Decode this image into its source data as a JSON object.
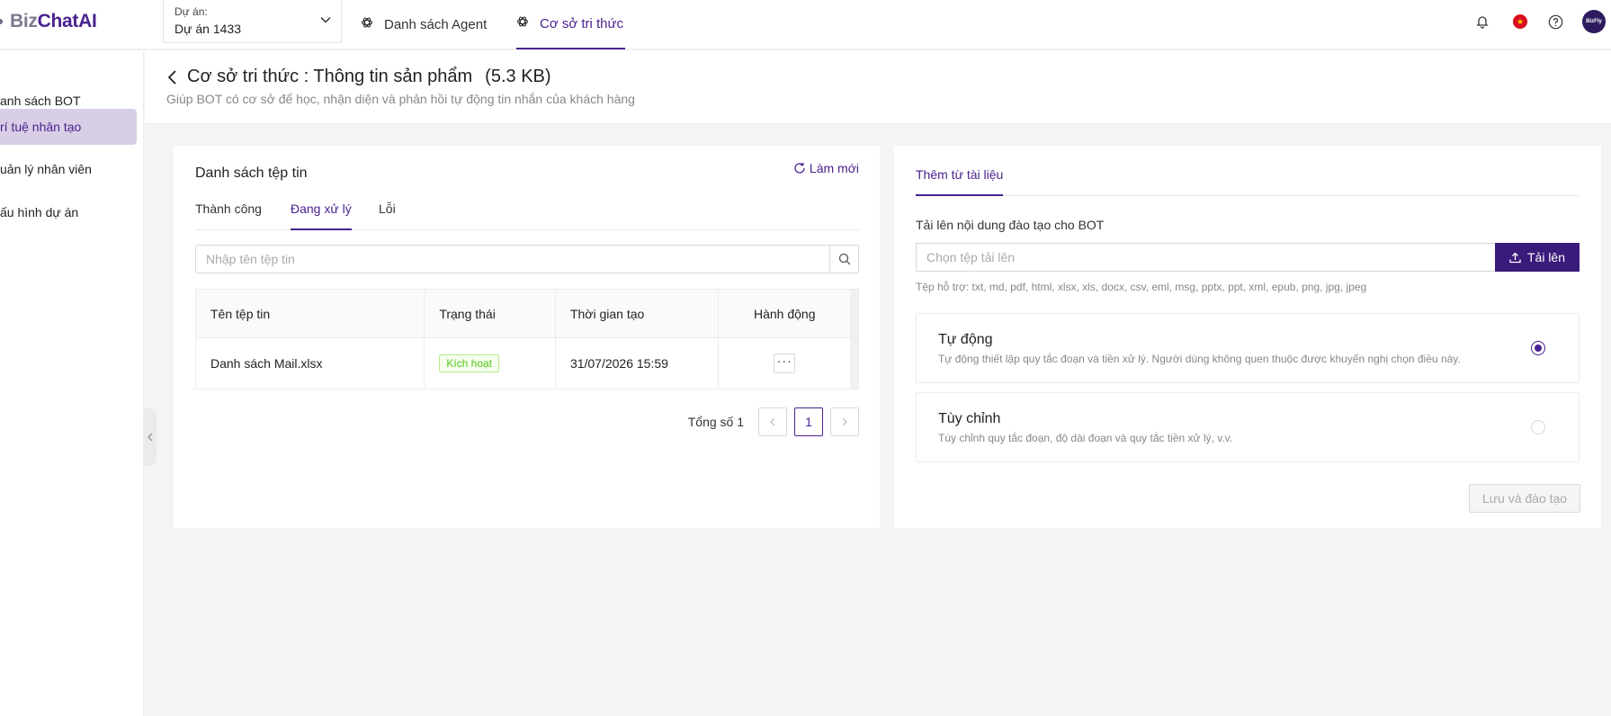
{
  "brand": {
    "part1": "Biz",
    "part2": "ChatAI"
  },
  "project": {
    "label": "Dự án:",
    "value": "Dự án 1433"
  },
  "nav": {
    "agents": "Danh sách Agent",
    "knowledge": "Cơ sở tri thức"
  },
  "avatar_text": "BizFly",
  "flag_glyph": "★",
  "sidebar": {
    "items": [
      {
        "label": "anh sách BOT"
      },
      {
        "label": "rí tuệ nhân tạo"
      },
      {
        "label": "uản lý nhân viên"
      },
      {
        "label": "ấu hình dự án"
      }
    ]
  },
  "page": {
    "title": "Cơ sở tri thức : Thông tin sản phẩm",
    "size": "(5.3 KB)",
    "subtitle": "Giúp BOT có cơ sở để học, nhận diện và phản hồi tự động tin nhắn của khách hàng"
  },
  "files": {
    "title": "Danh sách tệp tin",
    "refresh": "Làm mới",
    "tabs": [
      "Thành công",
      "Đang xử lý",
      "Lỗi"
    ],
    "search_placeholder": "Nhập tên tệp tin",
    "columns": [
      "Tên tệp tin",
      "Trạng thái",
      "Thời gian tạo",
      "Hành động"
    ],
    "rows": [
      {
        "name": "Danh sách Mail.xlsx",
        "status": "Kích hoạt",
        "created": "31/07/2026 15:59",
        "action": "···"
      }
    ],
    "pagination": {
      "total_label": "Tổng số 1",
      "current_page": "1"
    }
  },
  "upload": {
    "tab": "Thêm từ tài liệu",
    "label": "Tải lên nội dung đào tạo cho BOT",
    "placeholder": "Chọn tệp tải lên",
    "button": "Tải lên",
    "formats": "Tệp hỗ trợ: txt, md, pdf, html, xlsx, xls, docx, csv, eml, msg, pptx, ppt, xml, epub, png, jpg, jpeg",
    "options": [
      {
        "title": "Tự động",
        "desc": "Tự động thiết lập quy tắc đoạn và tiền xử lý. Người dùng không quen thuộc được khuyến nghị chọn điều này."
      },
      {
        "title": "Tùy chỉnh",
        "desc": "Tùy chỉnh quy tắc đoạn, độ dài đoạn và quy tắc tiền xử lý, v.v."
      }
    ],
    "selected_option": "Tự động",
    "save_button": "Lưu và đào tạo"
  },
  "colors": {
    "primary": "#4a2290",
    "upload_button": "#3a1a7a",
    "badge_green": "#52c41a",
    "sidebar_active": "#d8cfe6"
  }
}
